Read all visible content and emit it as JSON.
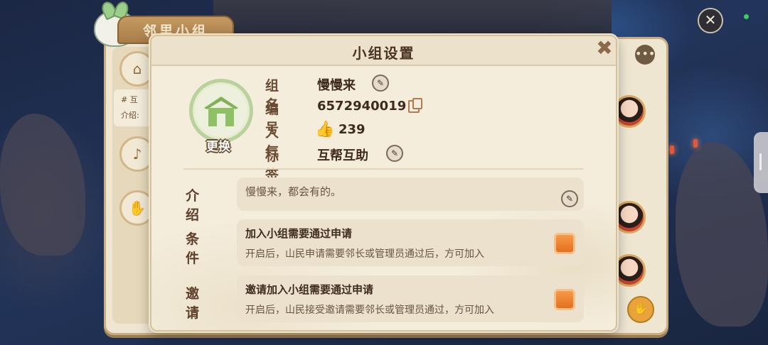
{
  "background": {
    "panel_tab": "邻里小组",
    "panel_card_line1": "# 互",
    "panel_card_line2": "介绍:"
  },
  "dialog": {
    "title": "小组设置",
    "emblem_change_label": "更换",
    "info": [
      {
        "label": "组名",
        "value": "慢慢来",
        "action": "edit-pen-icon"
      },
      {
        "label": "编号",
        "value": "6572940019",
        "action": "copy-icon"
      },
      {
        "label": "人气",
        "value": "239",
        "icon": "thumbs-up-icon"
      },
      {
        "label": "标签",
        "value": "互帮互助",
        "action": "edit-pen-icon"
      }
    ],
    "intro": {
      "label": "介绍",
      "text": "慢慢来，都会有的。"
    },
    "condition": {
      "label": "条件",
      "title": "加入小组需要通过申请",
      "desc": "开启后，山民申请需要邻长或管理员通过后，方可加入",
      "enabled": true
    },
    "invite": {
      "label": "邀请",
      "title": "邀请加入小组需要通过申请",
      "desc": "开启后，山民接受邀请需要邻长或管理员通过，方可加入",
      "enabled": true
    }
  },
  "colors": {
    "accent_toggle": "#f08a34",
    "dialog_bg": "#f4eddc",
    "text_brown": "#3f2b1e"
  }
}
